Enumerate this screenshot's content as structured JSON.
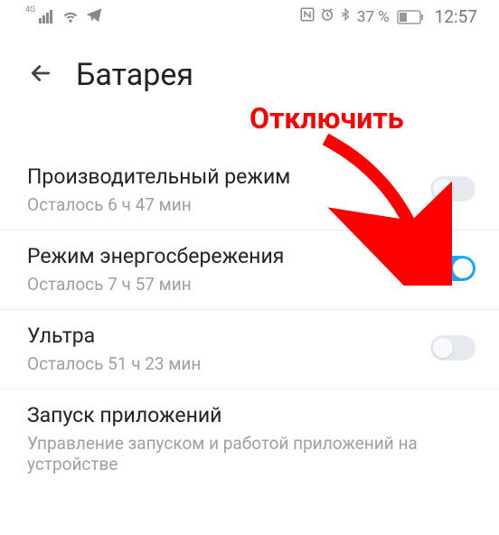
{
  "status": {
    "network_label": "4G",
    "battery_percent": "37 %",
    "clock": "12:57"
  },
  "header": {
    "title": "Батарея"
  },
  "annotation": {
    "label": "Отключить"
  },
  "rows": [
    {
      "title": "Производительный режим",
      "sub": "Осталось 6 ч 47 мин",
      "toggle": "off"
    },
    {
      "title": "Режим энергосбережения",
      "sub": "Осталось 7 ч 57 мин",
      "toggle": "on"
    },
    {
      "title": "Ультра",
      "sub": "Осталось 51 ч 23 мин",
      "toggle": "off"
    },
    {
      "title": "Запуск приложений",
      "sub": "Управление запуском и работой приложений на устройстве",
      "toggle": null
    }
  ]
}
